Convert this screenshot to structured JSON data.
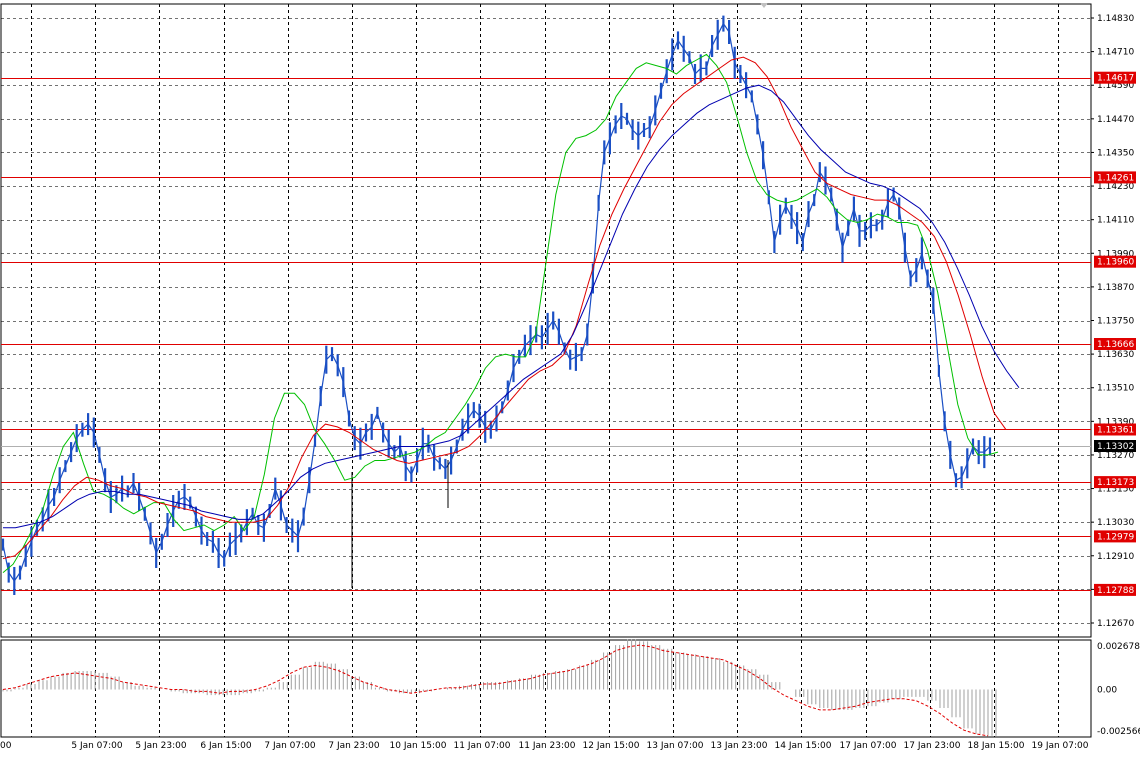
{
  "chart_data": {
    "type": "line",
    "title": "",
    "ylabel": "",
    "xlabel": "",
    "grid": true,
    "legend": "none",
    "colors": {
      "price": "#1a4fc4",
      "ma_fast": "#00c000",
      "ma_mid": "#e00000",
      "ma_slow": "#0000b0",
      "levels": "#e00000",
      "histogram": "#a0a0a0",
      "signal": "#e00000",
      "current_price_box": "#000000"
    },
    "price_panel": {
      "ylim": [
        1.1262,
        1.1488
      ],
      "y_ticks": [
        "1.14830",
        "1.14710",
        "1.14590",
        "1.14470",
        "1.14350",
        "1.14230",
        "1.14110",
        "1.13990",
        "1.13870",
        "1.13750",
        "1.13630",
        "1.13510",
        "1.13390",
        "1.13270",
        "1.13150",
        "1.13030",
        "1.12910",
        "1.12790",
        "1.12670"
      ],
      "levels": [
        "1.14617",
        "1.14261",
        "1.13960",
        "1.13666",
        "1.13361",
        "1.13173",
        "1.12979",
        "1.12788"
      ],
      "current_price": "1.13302",
      "series": [
        {
          "values": [
            1.1295,
            1.1285,
            1.1282,
            1.1285,
            1.1291,
            1.1296,
            1.1301,
            1.1304,
            1.1309,
            1.1312,
            1.1318,
            1.1323,
            1.1328,
            1.1333,
            1.1336,
            1.1338,
            1.1335,
            1.1327,
            1.1318,
            1.1312,
            1.1313,
            1.1315,
            1.1314,
            1.1317,
            1.1312,
            1.1306,
            1.1299,
            1.1292,
            1.1296,
            1.1302,
            1.1307,
            1.1311,
            1.1312,
            1.131,
            1.1305,
            1.13,
            1.1297,
            1.1296,
            1.1292,
            1.129,
            1.1295,
            1.1297,
            1.1299,
            1.1303,
            1.1306,
            1.1302,
            1.1301,
            1.1307,
            1.1315,
            1.1309,
            1.1302,
            1.13,
            1.1298,
            1.1305,
            1.1318,
            1.1332,
            1.1348,
            1.1361,
            1.1363,
            1.1359,
            1.1353,
            1.134,
            1.1333,
            1.1331,
            1.1335,
            1.1337,
            1.1342,
            1.1335,
            1.1331,
            1.1328,
            1.133,
            1.1323,
            1.132,
            1.1325,
            1.1331,
            1.1331,
            1.1326,
            1.1324,
            1.1322,
            1.1325,
            1.133,
            1.1336,
            1.134,
            1.1343,
            1.1341,
            1.1337,
            1.1336,
            1.134,
            1.1344,
            1.135,
            1.1358,
            1.1362,
            1.1366,
            1.1368,
            1.137,
            1.1369,
            1.1372,
            1.1375,
            1.1371,
            1.1365,
            1.1361,
            1.1362,
            1.1363,
            1.137,
            1.139,
            1.1417,
            1.1435,
            1.144,
            1.1445,
            1.1448,
            1.1447,
            1.1443,
            1.1441,
            1.1443,
            1.1444,
            1.145,
            1.1457,
            1.1464,
            1.147,
            1.1475,
            1.1472,
            1.1469,
            1.1463,
            1.1465,
            1.1465,
            1.1473,
            1.1477,
            1.1481,
            1.1478,
            1.1467,
            1.1463,
            1.1459,
            1.1455,
            1.1445,
            1.1434,
            1.1419,
            1.1403,
            1.1411,
            1.1416,
            1.1412,
            1.1408,
            1.1403,
            1.1413,
            1.1418,
            1.1428,
            1.1425,
            1.142,
            1.1411,
            1.1401,
            1.1408,
            1.1415,
            1.1407,
            1.1407,
            1.1409,
            1.1409,
            1.1411,
            1.1417,
            1.142,
            1.1415,
            1.1401,
            1.139,
            1.1393,
            1.1399,
            1.139,
            1.1382,
            1.1357,
            1.1339,
            1.1327,
            1.1318,
            1.1319,
            1.1324,
            1.133,
            1.1328,
            1.1328,
            1.133
          ]
        },
        {
          "values": [
            1.1285,
            1.1288,
            1.1294,
            1.1301,
            1.1308,
            1.132,
            1.133,
            1.1335,
            1.1324,
            1.1314,
            1.1313,
            1.1311,
            1.1308,
            1.1306,
            1.1308,
            1.131,
            1.131,
            1.1304,
            1.13,
            1.1301,
            1.1302,
            1.13,
            1.1302,
            1.1305,
            1.13,
            1.1305,
            1.132,
            1.134,
            1.1349,
            1.1349,
            1.1345,
            1.1336,
            1.1331,
            1.1325,
            1.1318,
            1.1319,
            1.1323,
            1.1325,
            1.1325,
            1.1326,
            1.1327,
            1.1328,
            1.133,
            1.1333,
            1.1335,
            1.134,
            1.1345,
            1.1351,
            1.1358,
            1.1362,
            1.1363,
            1.1362,
            1.1362,
            1.137,
            1.1395,
            1.142,
            1.1435,
            1.144,
            1.1441,
            1.1443,
            1.1447,
            1.1455,
            1.146,
            1.1465,
            1.1467,
            1.1466,
            1.1465,
            1.1463,
            1.1466,
            1.1468,
            1.147,
            1.1466,
            1.146,
            1.1448,
            1.1435,
            1.1425,
            1.142,
            1.1418,
            1.1417,
            1.1418,
            1.142,
            1.1422,
            1.1419,
            1.1414,
            1.1411,
            1.141,
            1.1411,
            1.1413,
            1.1412,
            1.141,
            1.141,
            1.1409,
            1.14,
            1.1385,
            1.1365,
            1.1345,
            1.1333,
            1.1327,
            1.1327,
            1.1328
          ]
        },
        {
          "values": [
            1.129,
            1.1291,
            1.1295,
            1.13,
            1.1305,
            1.1311,
            1.1316,
            1.1319,
            1.1318,
            1.1316,
            1.1315,
            1.1313,
            1.1312,
            1.131,
            1.1309,
            1.1308,
            1.1307,
            1.1305,
            1.1304,
            1.1303,
            1.1303,
            1.1303,
            1.1304,
            1.1309,
            1.1316,
            1.1326,
            1.1334,
            1.1338,
            1.1337,
            1.1335,
            1.1332,
            1.1329,
            1.1327,
            1.1325,
            1.1324,
            1.1325,
            1.1326,
            1.1327,
            1.1328,
            1.133,
            1.1334,
            1.1339,
            1.1344,
            1.1349,
            1.1354,
            1.1357,
            1.1359,
            1.1363,
            1.1373,
            1.1388,
            1.1402,
            1.1413,
            1.1422,
            1.143,
            1.1438,
            1.1446,
            1.1452,
            1.1456,
            1.1459,
            1.1462,
            1.1465,
            1.1468,
            1.1469,
            1.1467,
            1.1462,
            1.1454,
            1.1444,
            1.1436,
            1.1428,
            1.1424,
            1.1422,
            1.142,
            1.1419,
            1.1418,
            1.1418,
            1.1416,
            1.1413,
            1.141,
            1.1405,
            1.1396,
            1.1384,
            1.137,
            1.1355,
            1.1342,
            1.1336
          ]
        },
        {
          "values": [
            1.1301,
            1.1301,
            1.1302,
            1.1303,
            1.1305,
            1.1308,
            1.1311,
            1.1313,
            1.1314,
            1.1314,
            1.1313,
            1.1313,
            1.1312,
            1.1311,
            1.131,
            1.1309,
            1.1307,
            1.1306,
            1.1305,
            1.1304,
            1.1304,
            1.1306,
            1.131,
            1.1314,
            1.1319,
            1.1322,
            1.1324,
            1.1325,
            1.1326,
            1.1327,
            1.1328,
            1.1329,
            1.133,
            1.133,
            1.133,
            1.1331,
            1.1332,
            1.1334,
            1.1338,
            1.1342,
            1.1346,
            1.135,
            1.1354,
            1.1357,
            1.136,
            1.1363,
            1.137,
            1.138,
            1.1391,
            1.1402,
            1.1413,
            1.1422,
            1.143,
            1.1436,
            1.1441,
            1.1445,
            1.1449,
            1.1452,
            1.1454,
            1.1456,
            1.1458,
            1.1459,
            1.1457,
            1.1453,
            1.1447,
            1.1441,
            1.1436,
            1.1432,
            1.1428,
            1.1426,
            1.1424,
            1.1423,
            1.1421,
            1.1418,
            1.1415,
            1.141,
            1.1403,
            1.1394,
            1.1384,
            1.1373,
            1.1364,
            1.1357,
            1.1351
          ]
        }
      ]
    },
    "oscillator_panel": {
      "ylim": [
        -0.002566,
        0.002678
      ],
      "y_ticks": [
        "0.002678",
        "0.00",
        "-0.002566"
      ],
      "histogram": [
        -0.0001,
        0.0001,
        0.0003,
        0.0005,
        0.0007,
        0.0009,
        0.001,
        0.001,
        0.0009,
        0.0007,
        0.0004,
        0.0002,
        0.0001,
        0.0,
        -0.0001,
        -0.0002,
        -0.0002,
        -0.0003,
        -0.0003,
        -0.0003,
        -0.0002,
        -0.0001,
        0.0001,
        0.0004,
        0.0008,
        0.0012,
        0.0015,
        0.0014,
        0.0011,
        0.0007,
        0.0004,
        0.0001,
        -0.0001,
        -0.0002,
        -0.0002,
        -0.0001,
        0.0,
        0.0001,
        0.0002,
        0.0003,
        0.0004,
        0.0004,
        0.0005,
        0.0006,
        0.0008,
        0.0009,
        0.001,
        0.0011,
        0.0013,
        0.0016,
        0.002,
        0.0024,
        0.0027,
        0.0026,
        0.0024,
        0.0022,
        0.002,
        0.0019,
        0.0018,
        0.0017,
        0.0015,
        0.0013,
        0.0011,
        0.0008,
        0.0004,
        0.0,
        -0.0004,
        -0.0008,
        -0.001,
        -0.0011,
        -0.0011,
        -0.001,
        -0.0009,
        -0.0007,
        -0.0005,
        -0.0004,
        -0.0004,
        -0.0006,
        -0.001,
        -0.0015,
        -0.0021,
        -0.0024,
        -0.0025
      ],
      "signal": [
        0.0,
        0.0001,
        0.0003,
        0.0005,
        0.0007,
        0.0008,
        0.0009,
        0.0008,
        0.0007,
        0.0006,
        0.0004,
        0.0003,
        0.0002,
        0.0001,
        0.0,
        0.0,
        -0.0001,
        -0.0001,
        -0.0002,
        -0.0001,
        -0.0001,
        0.0,
        0.0002,
        0.0005,
        0.0009,
        0.0012,
        0.0013,
        0.0012,
        0.001,
        0.0007,
        0.0004,
        0.0002,
        0.0,
        -0.0001,
        -0.0002,
        -0.0001,
        0.0,
        0.0001,
        0.0001,
        0.0002,
        0.0003,
        0.0003,
        0.0004,
        0.0005,
        0.0006,
        0.0008,
        0.0009,
        0.001,
        0.0012,
        0.0014,
        0.0017,
        0.0021,
        0.0023,
        0.0024,
        0.0023,
        0.0021,
        0.002,
        0.0019,
        0.0018,
        0.0017,
        0.0016,
        0.0013,
        0.001,
        0.0006,
        0.0001,
        -0.0003,
        -0.0006,
        -0.0009,
        -0.0011,
        -0.0011,
        -0.001,
        -0.0009,
        -0.0007,
        -0.0006,
        -0.0005,
        -0.0005,
        -0.0006,
        -0.0009,
        -0.0013,
        -0.0018,
        -0.0022,
        -0.0024,
        -0.0025
      ]
    },
    "x_ticks": [
      "00",
      "5 Jan 07:00",
      "5 Jan 23:00",
      "6 Jan 15:00",
      "7 Jan 07:00",
      "7 Jan 23:00",
      "10 Jan 15:00",
      "11 Jan 07:00",
      "11 Jan 23:00",
      "12 Jan 15:00",
      "13 Jan 07:00",
      "13 Jan 23:00",
      "14 Jan 15:00",
      "17 Jan 07:00",
      "17 Jan 23:00",
      "18 Jan 15:00",
      "19 Jan 07:00"
    ]
  }
}
